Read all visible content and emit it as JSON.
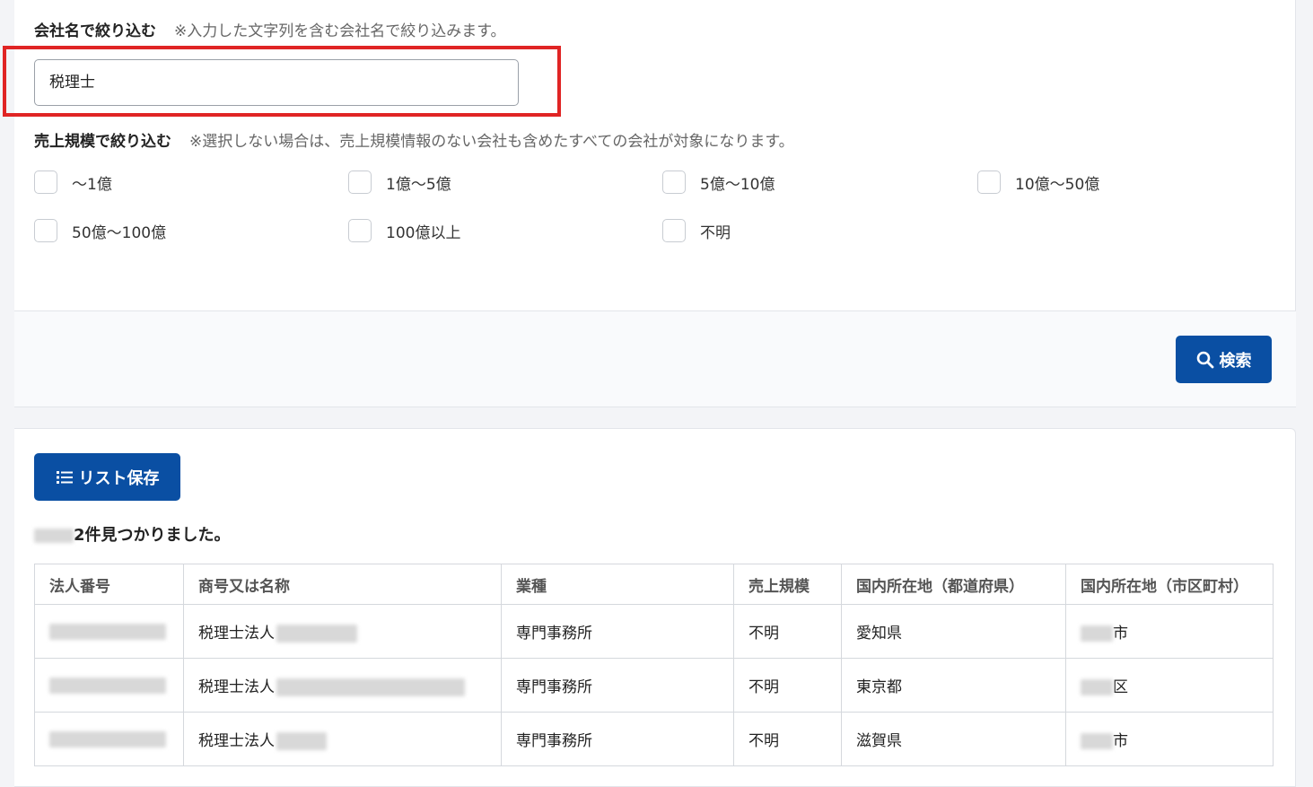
{
  "filters": {
    "company_name": {
      "label": "会社名で絞り込む",
      "note": "※入力した文字列を含む会社名で絞り込みます。",
      "value": "税理士"
    },
    "sales_scale": {
      "label": "売上規模で絞り込む",
      "note": "※選択しない場合は、売上規模情報のない会社も含めたすべての会社が対象になります。",
      "options": [
        "〜1億",
        "1億〜5億",
        "5億〜10億",
        "10億〜50億",
        "50億〜100億",
        "100億以上",
        "不明"
      ]
    }
  },
  "search_button": {
    "label": "検索",
    "icon": "search-icon"
  },
  "list_save_button": {
    "label": "リスト保存",
    "icon": "list-icon"
  },
  "results": {
    "count_suffix": "2件見つかりました。",
    "columns": [
      "法人番号",
      "商号又は名称",
      "業種",
      "売上規模",
      "国内所在地（都道府県）",
      "国内所在地（市区町村）"
    ],
    "rows": [
      {
        "name_prefix": "税理士法人",
        "industry": "専門事務所",
        "sales": "不明",
        "prefecture": "愛知県",
        "city_suffix": "市"
      },
      {
        "name_prefix": "税理士法人",
        "industry": "専門事務所",
        "sales": "不明",
        "prefecture": "東京都",
        "city_suffix": "区"
      },
      {
        "name_prefix": "税理士法人",
        "industry": "専門事務所",
        "sales": "不明",
        "prefecture": "滋賀県",
        "city_suffix": "市"
      }
    ]
  },
  "colors": {
    "accent": "#0a4fa3",
    "highlight_border": "#e02424"
  }
}
